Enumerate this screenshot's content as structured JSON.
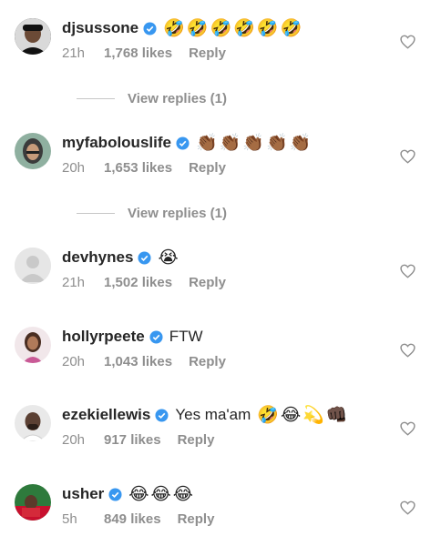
{
  "comments": [
    {
      "username": "djsussone",
      "text": "",
      "emojis": [
        "🤣",
        "🤣",
        "🤣",
        "🤣",
        "🤣",
        "🤣"
      ],
      "time": "21h",
      "likes": "1,768 likes",
      "reply": "Reply",
      "view_replies": "View replies (1)"
    },
    {
      "username": "myfabolouslife",
      "text": "",
      "emojis": [
        "👏🏾",
        "👏🏾",
        "👏🏾",
        "👏🏾",
        "👏🏾"
      ],
      "time": "20h",
      "likes": "1,653 likes",
      "reply": "Reply",
      "view_replies": "View replies (1)"
    },
    {
      "username": "devhynes",
      "text": "",
      "emojis": [
        "😭"
      ],
      "time": "21h",
      "likes": "1,502 likes",
      "reply": "Reply"
    },
    {
      "username": "hollyrpeete",
      "text": "FTW",
      "emojis": [],
      "time": "20h",
      "likes": "1,043 likes",
      "reply": "Reply"
    },
    {
      "username": "ezekiellewis",
      "text": "Yes ma'am",
      "emojis": [
        "🤣",
        "😂",
        "💫",
        "👊🏿"
      ],
      "time": "20h",
      "likes": "917 likes",
      "reply": "Reply"
    },
    {
      "username": "usher",
      "text": "",
      "emojis": [
        "😂",
        "😂",
        "😂"
      ],
      "time": "5h",
      "likes": "849 likes",
      "reply": "Reply"
    }
  ],
  "colors": {
    "verified": "#3897f0",
    "meta_text": "#8e8e8e",
    "username": "#262626"
  }
}
